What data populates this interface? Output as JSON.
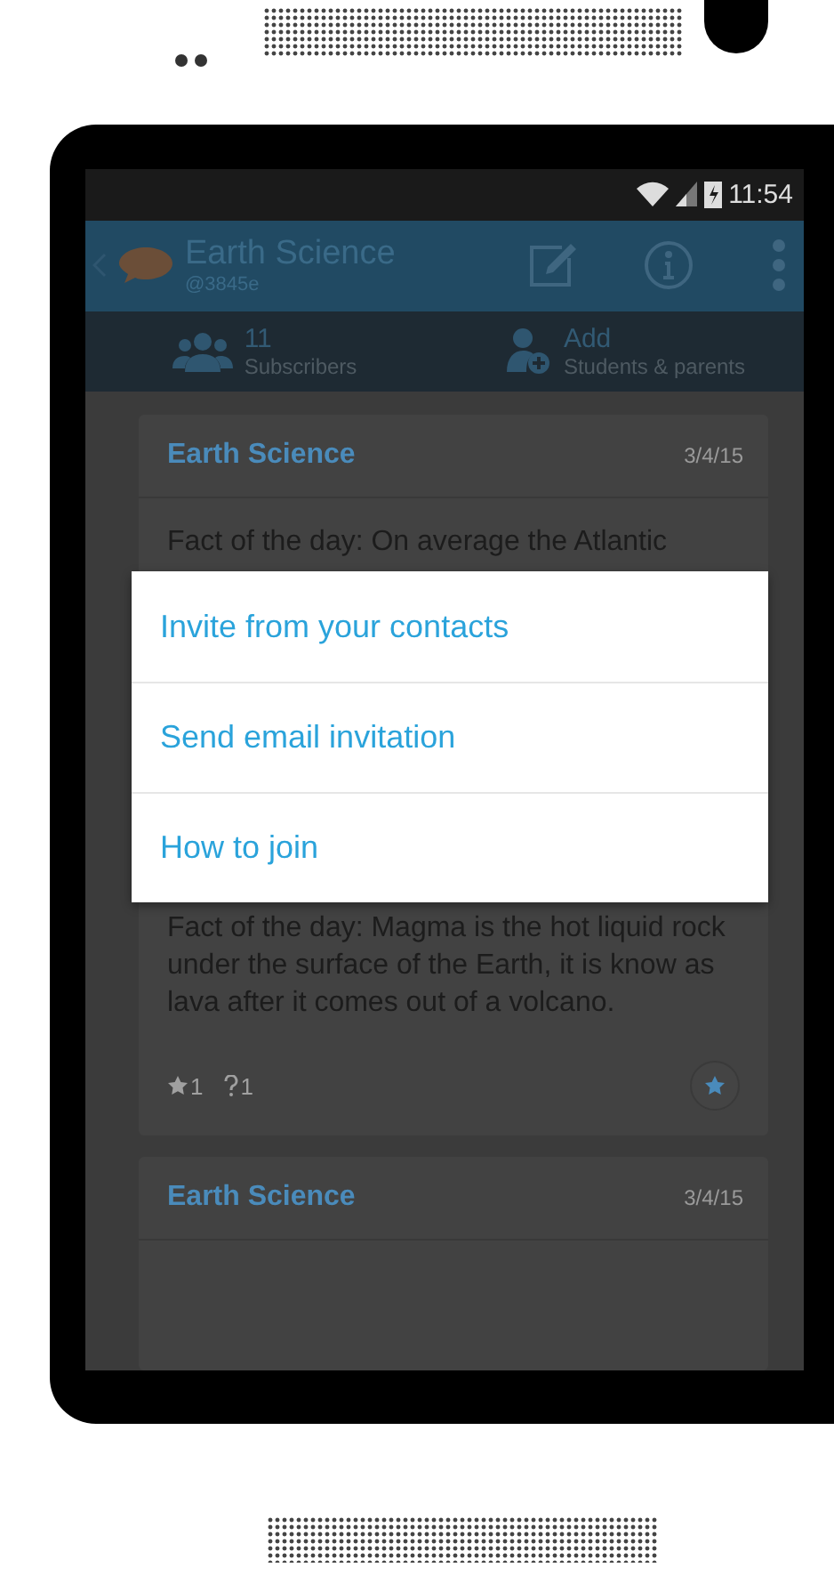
{
  "status_bar": {
    "time": "11:54"
  },
  "app_bar": {
    "title": "Earth Science",
    "code": "@3845e"
  },
  "tabs": [
    {
      "kind": "subscribers",
      "value": "11",
      "label": "Subscribers"
    },
    {
      "kind": "add",
      "value": "Add",
      "label": "Students & parents"
    }
  ],
  "posts": [
    {
      "title": "Earth Science",
      "date": "3/4/15",
      "body": "Fact of the day: On average the Atlantic"
    },
    {
      "body": "Fact of the day: Magma is the hot liquid rock under the surface of the Earth, it is know as lava after it comes out of a volcano.",
      "stars": "1",
      "questions": "1"
    },
    {
      "title": "Earth Science",
      "date": "3/4/15"
    }
  ],
  "dialog": {
    "items": [
      "Invite from your contacts",
      "Send email invitation",
      "How to join"
    ]
  }
}
